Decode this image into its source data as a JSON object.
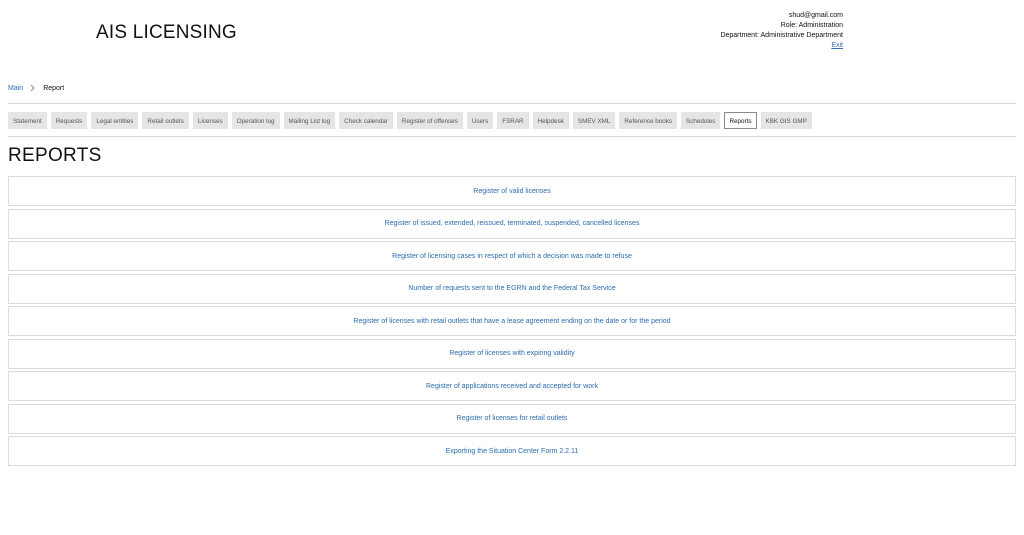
{
  "header": {
    "app_title": "AIS LICENSING",
    "user": {
      "email": "shud@gmail.com",
      "role": "Role: Administration",
      "department": "Department: Administrative Department",
      "exit_label": "Exit"
    }
  },
  "breadcrumb": {
    "home": "Main",
    "separator_icon": "chevron-right-icon",
    "current": "Report"
  },
  "tabs": [
    {
      "label": "Statement"
    },
    {
      "label": "Requests"
    },
    {
      "label": "Legal entities"
    },
    {
      "label": "Retail outlets"
    },
    {
      "label": "Licenses"
    },
    {
      "label": "Operation log"
    },
    {
      "label": "Mailing List log"
    },
    {
      "label": "Check calendar"
    },
    {
      "label": "Register of offenses"
    },
    {
      "label": "Users"
    },
    {
      "label": "FSRAR"
    },
    {
      "label": "Helpdesk"
    },
    {
      "label": "SMEV XML"
    },
    {
      "label": "Reference books"
    },
    {
      "label": "Schedules"
    },
    {
      "label": "Reports",
      "active": true
    },
    {
      "label": "KBK GIS GMP"
    }
  ],
  "page_title": "REPORTS",
  "reports": [
    {
      "label": "Register of valid licenses"
    },
    {
      "label": "Register of issued, extended, reissued, terminated, suspended, cancelled licenses"
    },
    {
      "label": "Register of licensing cases in respect of which a decision was made to refuse"
    },
    {
      "label": "Number of requests sent to the EGRN and the Federal Tax Service"
    },
    {
      "label": "Register of licenses with retail outlets that have a lease agreement ending on the date or for the period"
    },
    {
      "label": "Register of licenses with expiring validity"
    },
    {
      "label": "Register of applications received and accepted for work"
    },
    {
      "label": "Register of licenses for retail outlets"
    },
    {
      "label": "Exporting the Situation Center Form 2.2.11"
    }
  ],
  "colors": {
    "link": "#2a6cb0",
    "tab_bg": "#e5e5e5",
    "border": "#dcdcdc"
  }
}
